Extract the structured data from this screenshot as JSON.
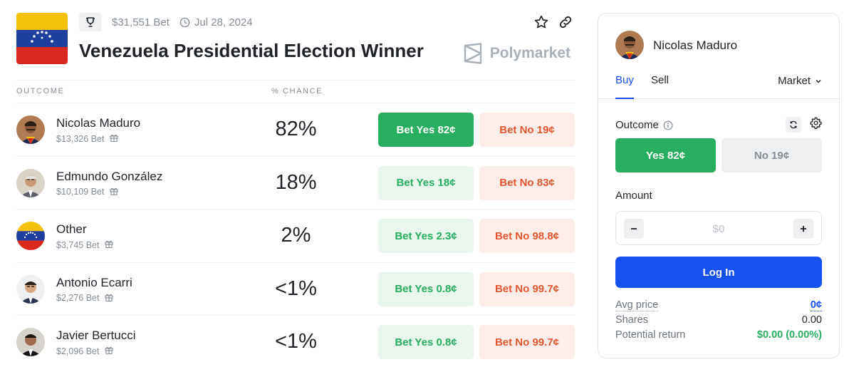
{
  "market": {
    "volume": "$31,551 Bet",
    "date": "Jul 28, 2024",
    "title": "Venezuela Presidential Election Winner",
    "brand": "Polymarket",
    "colors": {
      "yes": "#27ae60",
      "no": "#e4572e",
      "accent": "#1652f0"
    }
  },
  "table": {
    "col_outcome": "OUTCOME",
    "col_chance": "% CHANCE",
    "rows": [
      {
        "name": "Nicolas Maduro",
        "bet": "$13,326 Bet",
        "chance": "82%",
        "yes": "Bet Yes 82¢",
        "no": "Bet No 19¢",
        "selected": true
      },
      {
        "name": "Edmundo González",
        "bet": "$10,109 Bet",
        "chance": "18%",
        "yes": "Bet Yes 18¢",
        "no": "Bet No 83¢"
      },
      {
        "name": "Other",
        "bet": "$3,745 Bet",
        "chance": "2%",
        "yes": "Bet Yes 2.3¢",
        "no": "Bet No 98.8¢"
      },
      {
        "name": "Antonio Ecarri",
        "bet": "$2,276 Bet",
        "chance": "<1%",
        "yes": "Bet Yes 0.8¢",
        "no": "Bet No 99.7¢"
      },
      {
        "name": "Javier Bertucci",
        "bet": "$2,096 Bet",
        "chance": "<1%",
        "yes": "Bet Yes 0.8¢",
        "no": "Bet No 99.7¢"
      }
    ]
  },
  "trade": {
    "candidate": "Nicolas Maduro",
    "tab_buy": "Buy",
    "tab_sell": "Sell",
    "order_type": "Market",
    "outcome_label": "Outcome",
    "yes_label": "Yes 82¢",
    "no_label": "No 19¢",
    "amount_label": "Amount",
    "amount_placeholder": "$0",
    "login_label": "Log In",
    "avg_price_label": "Avg price",
    "avg_price": "0¢",
    "shares_label": "Shares",
    "shares": "0.00",
    "return_label": "Potential return",
    "return_value": "$0.00 (0.00%)"
  }
}
